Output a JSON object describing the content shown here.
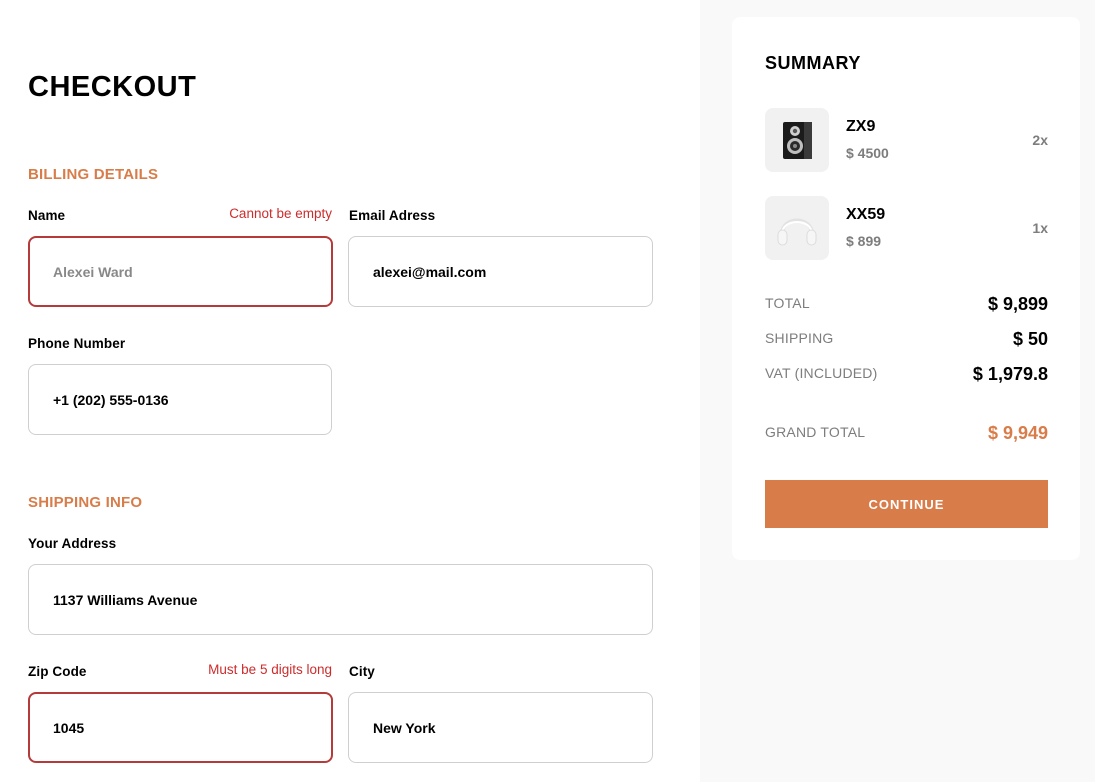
{
  "checkout": {
    "title": "CHECKOUT",
    "billing": {
      "heading": "BILLING DETAILS",
      "name": {
        "label": "Name",
        "error": "Cannot be empty",
        "placeholder": "Alexei Ward",
        "value": ""
      },
      "email": {
        "label": "Email Adress",
        "value": "alexei@mail.com"
      },
      "phone": {
        "label": "Phone Number",
        "value": "+1 (202) 555-0136"
      }
    },
    "shipping": {
      "heading": "SHIPPING INFO",
      "address": {
        "label": "Your Address",
        "value": "1137 Williams Avenue"
      },
      "zip": {
        "label": "Zip Code",
        "error": "Must be 5 digits long",
        "value": "1045"
      },
      "city": {
        "label": "City",
        "value": "New York"
      }
    }
  },
  "summary": {
    "title": "SUMMARY",
    "items": [
      {
        "name": "ZX9",
        "price": "$ 4500",
        "qty": "2x",
        "icon": "speaker-icon"
      },
      {
        "name": "XX59",
        "price": "$ 899",
        "qty": "1x",
        "icon": "headphones-icon"
      }
    ],
    "totals": {
      "total": {
        "label": "TOTAL",
        "value": "$ 9,899"
      },
      "shipping": {
        "label": "SHIPPING",
        "value": "$ 50"
      },
      "vat": {
        "label": "VAT (INCLUDED)",
        "value": "$ 1,979.8"
      },
      "grand": {
        "label": "GRAND TOTAL",
        "value": "$ 9,949"
      }
    },
    "continue_label": "CONTINUE"
  },
  "colors": {
    "accent": "#d87d4a",
    "error": "#cd2c2c",
    "error_border": "#b53a3a",
    "page_background": "#f9f9f9"
  }
}
